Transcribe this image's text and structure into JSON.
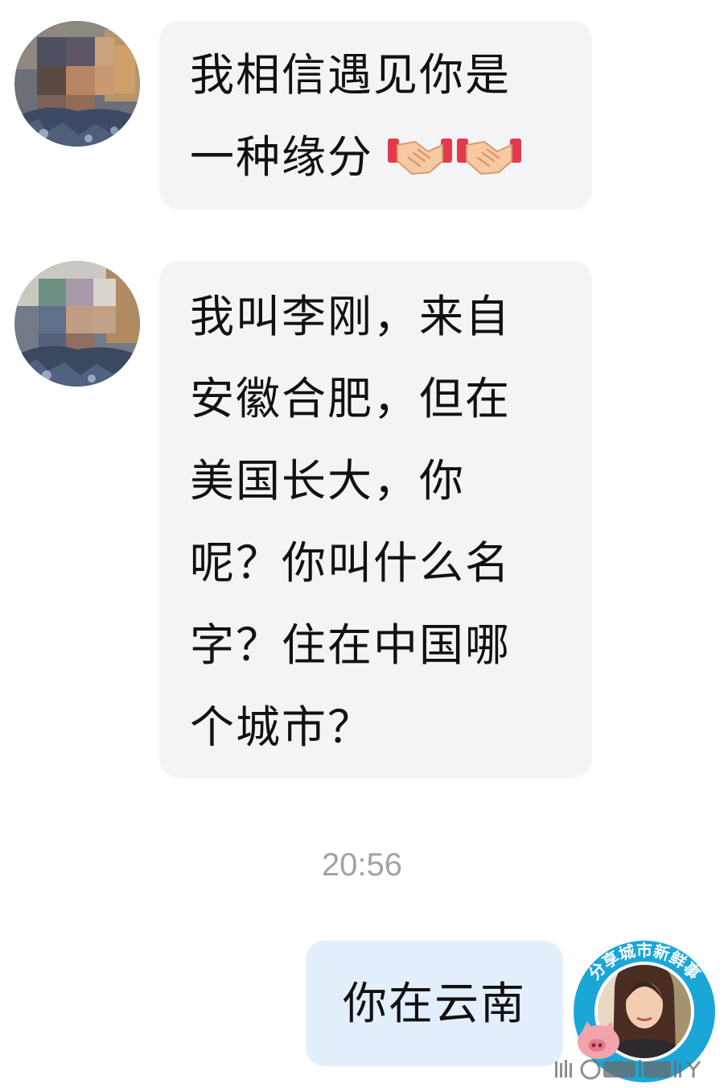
{
  "messages": [
    {
      "sender": "other",
      "lines": [
        "我相信遇见你是",
        "一种缘分"
      ],
      "emoji": [
        "handshake-emoji",
        "handshake-emoji"
      ]
    },
    {
      "sender": "other",
      "lines": [
        "我叫李刚，来自",
        "安徽合肥，但在",
        "美国长大，你",
        "呢？你叫什么名",
        "字？住在中国哪",
        "个城市？"
      ]
    },
    {
      "sender": "me",
      "lines": [
        "你在云南"
      ]
    }
  ],
  "timestamp": "20:56",
  "watermark": {
    "badge_text": "分享城市新鲜事"
  },
  "colors": {
    "incoming_bubble": "#f4f4f6",
    "outgoing_bubble": "#e3effb",
    "timestamp": "#a3a3a3",
    "badge_ring": "#1aa7d8"
  }
}
